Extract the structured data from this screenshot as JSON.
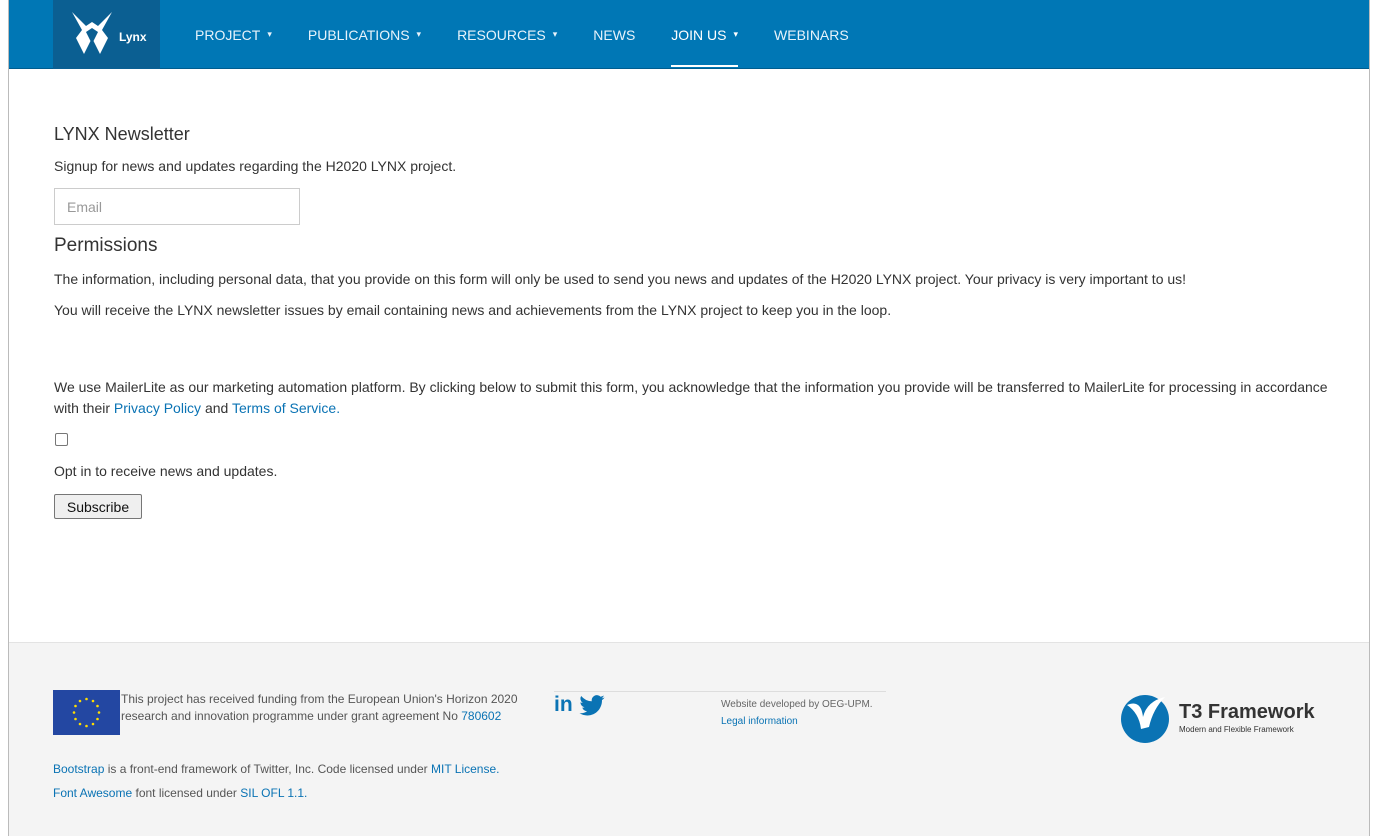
{
  "nav": {
    "logo_text": "Lynx",
    "items": [
      {
        "label": "PROJECT",
        "caret": "▾"
      },
      {
        "label": "PUBLICATIONS",
        "caret": "▾"
      },
      {
        "label": "RESOURCES",
        "caret": "▾"
      },
      {
        "label": "NEWS",
        "caret": ""
      },
      {
        "label": "JOIN US",
        "caret": "▾"
      },
      {
        "label": "WEBINARS",
        "caret": ""
      }
    ],
    "active": "JOIN US",
    "bg_color": "#0077b5"
  },
  "form": {
    "title": "LYNX Newsletter",
    "intro": "Signup for news and updates regarding the H2020 LYNX project.",
    "email_placeholder": "Email",
    "permissions_title": "Permissions",
    "permissions_p1": "The information, including personal data, that you provide on this form will only be used to send you news and updates of the H2020 LYNX project. Your privacy is very important to us!",
    "permissions_p2": "You will receive the LYNX newsletter issues by email containing news and achievements from the LYNX project to keep you in the loop.",
    "legal_text": "We use MailerLite as our marketing automation platform. By clicking below to submit this form, you acknowledge that the information you provide will be transferred to MailerLite for processing in accordance with their",
    "privacy_link": "Privacy Policy",
    "and_text": "and",
    "terms_link": "Terms of Service.",
    "optin_label": "Opt in to receive news and updates.",
    "subscribe_label": "Subscribe"
  },
  "footer": {
    "funding_text": "This project has received funding from the European Union's Horizon 2020 research and innovation programme under grant agreement No",
    "grant_number": "780602",
    "developed_by": "Website developed by OEG-UPM.",
    "legal_info": "Legal information",
    "t3_name": "T3 Framework",
    "t3_sub": "Modern and Flexible Framework",
    "bootstrap_link": "Bootstrap",
    "bootstrap_text": "is a front-end framework of Twitter, Inc. Code licensed under",
    "mit_link": "MIT License.",
    "fa_link": "Font Awesome",
    "fa_text": "font licensed under",
    "sil_link": "SIL OFL 1.1."
  }
}
